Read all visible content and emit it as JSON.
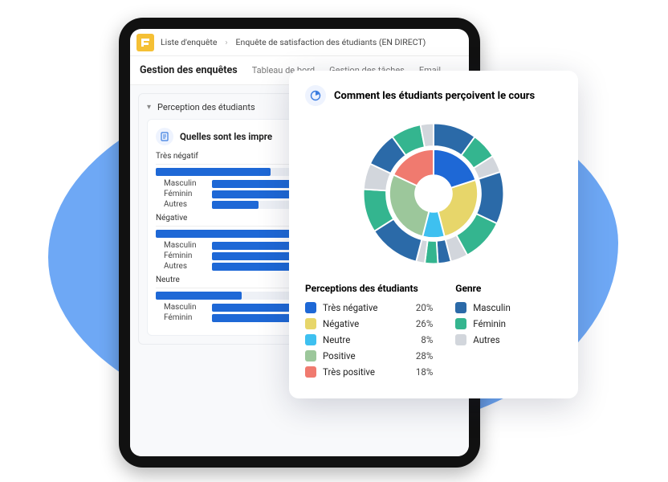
{
  "breadcrumb": {
    "item1": "Liste d'enquête",
    "item2": "Enquête de satisfaction des étudiants (EN DIRECT)"
  },
  "header": {
    "title": "Gestion des enquêtes",
    "tabs": [
      "Tableau de bord",
      "Gestion des tâches",
      "Email"
    ]
  },
  "section": {
    "title": "Perception des étudiants"
  },
  "card": {
    "title": "Quelles sont les impre",
    "groups": [
      {
        "label": "Très négatif",
        "top": 40,
        "rows": [
          {
            "label": "Masculin",
            "val": 55
          },
          {
            "label": "Féminin",
            "val": 35
          },
          {
            "label": "Autres",
            "val": 20
          }
        ]
      },
      {
        "label": "Négative",
        "top": 60,
        "rows": [
          {
            "label": "Masculin",
            "val": 60
          },
          {
            "label": "Féminin",
            "val": 58
          },
          {
            "label": "Autres",
            "val": 40
          }
        ]
      },
      {
        "label": "Neutre",
        "top": 30,
        "rows": [
          {
            "label": "Masculin",
            "val": 42
          },
          {
            "label": "Féminin",
            "val": 70
          }
        ]
      }
    ]
  },
  "overlay": {
    "title": "Comment les étudiants perçoivent le cours",
    "perceptions_title": "Perceptions des étudiants",
    "genre_title": "Genre",
    "perceptions": [
      {
        "label": "Très négative",
        "pct": "20%",
        "color": "#1e68d6"
      },
      {
        "label": "Négative",
        "pct": "26%",
        "color": "#e7d66a"
      },
      {
        "label": "Neutre",
        "pct": "8%",
        "color": "#3ec0f0"
      },
      {
        "label": "Positive",
        "pct": "28%",
        "color": "#9cc79b"
      },
      {
        "label": "Très positive",
        "pct": "18%",
        "color": "#f07a6f"
      }
    ],
    "genres": [
      {
        "label": "Masculin",
        "color": "#2b6aa8"
      },
      {
        "label": "Féminin",
        "color": "#34b58f"
      },
      {
        "label": "Autres",
        "color": "#d2d6dc"
      }
    ]
  },
  "chart_data": {
    "type": "pie",
    "title": "Comment les étudiants perçoivent le cours",
    "series": [
      {
        "name": "Perceptions des étudiants",
        "ring": "inner",
        "slices": [
          {
            "label": "Très négative",
            "value": 20,
            "color": "#1e68d6"
          },
          {
            "label": "Négative",
            "value": 26,
            "color": "#e7d66a"
          },
          {
            "label": "Neutre",
            "value": 8,
            "color": "#3ec0f0"
          },
          {
            "label": "Positive",
            "value": 28,
            "color": "#9cc79b"
          },
          {
            "label": "Très positive",
            "value": 18,
            "color": "#f07a6f"
          }
        ]
      },
      {
        "name": "Genre",
        "ring": "outer",
        "slices": [
          {
            "parent": "Très négative",
            "label": "Masculin",
            "value": 10,
            "color": "#2b6aa8"
          },
          {
            "parent": "Très négative",
            "label": "Féminin",
            "value": 6,
            "color": "#34b58f"
          },
          {
            "parent": "Très négative",
            "label": "Autres",
            "value": 4,
            "color": "#d2d6dc"
          },
          {
            "parent": "Négative",
            "label": "Masculin",
            "value": 12,
            "color": "#2b6aa8"
          },
          {
            "parent": "Négative",
            "label": "Féminin",
            "value": 10,
            "color": "#34b58f"
          },
          {
            "parent": "Négative",
            "label": "Autres",
            "value": 4,
            "color": "#d2d6dc"
          },
          {
            "parent": "Neutre",
            "label": "Masculin",
            "value": 3,
            "color": "#2b6aa8"
          },
          {
            "parent": "Neutre",
            "label": "Féminin",
            "value": 3,
            "color": "#34b58f"
          },
          {
            "parent": "Neutre",
            "label": "Autres",
            "value": 2,
            "color": "#d2d6dc"
          },
          {
            "parent": "Positive",
            "label": "Masculin",
            "value": 12,
            "color": "#2b6aa8"
          },
          {
            "parent": "Positive",
            "label": "Féminin",
            "value": 10,
            "color": "#34b58f"
          },
          {
            "parent": "Positive",
            "label": "Autres",
            "value": 6,
            "color": "#d2d6dc"
          },
          {
            "parent": "Très positive",
            "label": "Masculin",
            "value": 8,
            "color": "#2b6aa8"
          },
          {
            "parent": "Très positive",
            "label": "Féminin",
            "value": 7,
            "color": "#34b58f"
          },
          {
            "parent": "Très positive",
            "label": "Autres",
            "value": 3,
            "color": "#d2d6dc"
          }
        ]
      }
    ]
  }
}
